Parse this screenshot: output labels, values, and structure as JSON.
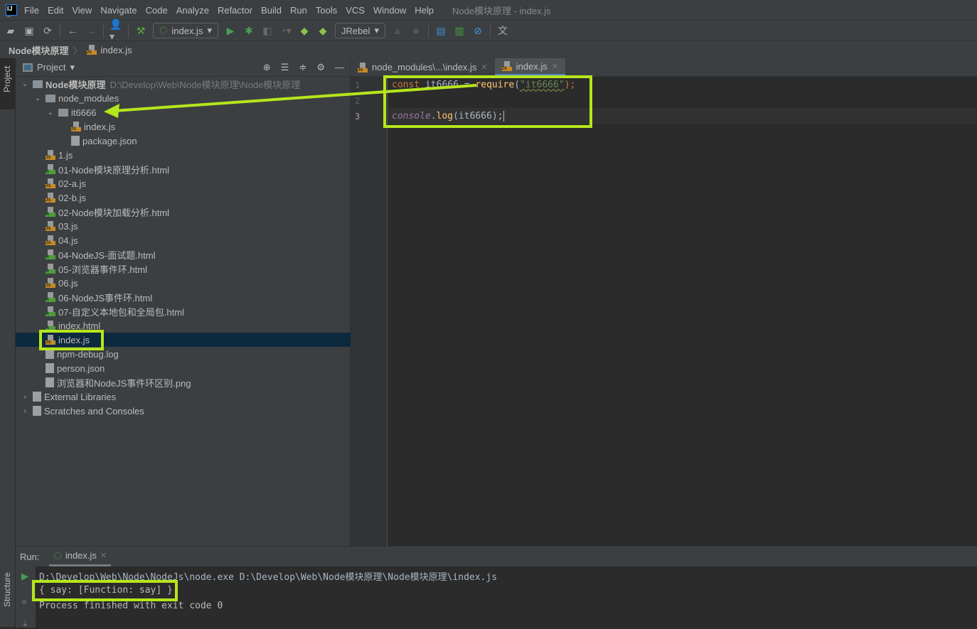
{
  "window_title": "Node模块原理 - index.js",
  "menu": [
    "File",
    "Edit",
    "View",
    "Navigate",
    "Code",
    "Analyze",
    "Refactor",
    "Build",
    "Run",
    "Tools",
    "VCS",
    "Window",
    "Help"
  ],
  "toolbar": {
    "run_config": "index.js",
    "jrebel": "JRebel"
  },
  "breadcrumb": {
    "project": "Node模块原理",
    "file": "index.js"
  },
  "side_tabs": {
    "project": "Project",
    "structure": "Structure"
  },
  "project_panel": {
    "title": "Project",
    "tree": [
      {
        "label": "Node模块原理",
        "path": "D:\\Develop\\Web\\Node模块原理\\Node模块原理",
        "depth": 0,
        "type": "module",
        "expanded": true
      },
      {
        "label": "node_modules",
        "depth": 1,
        "type": "folder",
        "expanded": true
      },
      {
        "label": "it6666",
        "depth": 2,
        "type": "folder",
        "expanded": true
      },
      {
        "label": "index.js",
        "depth": 3,
        "type": "js"
      },
      {
        "label": "package.json",
        "depth": 3,
        "type": "json"
      },
      {
        "label": "1.js",
        "depth": 1,
        "type": "js"
      },
      {
        "label": "01-Node模块原理分析.html",
        "depth": 1,
        "type": "html"
      },
      {
        "label": "02-a.js",
        "depth": 1,
        "type": "js"
      },
      {
        "label": "02-b.js",
        "depth": 1,
        "type": "js"
      },
      {
        "label": "02-Node模块加载分析.html",
        "depth": 1,
        "type": "html"
      },
      {
        "label": "03.js",
        "depth": 1,
        "type": "js"
      },
      {
        "label": "04.js",
        "depth": 1,
        "type": "js"
      },
      {
        "label": "04-NodeJS-面试题.html",
        "depth": 1,
        "type": "html"
      },
      {
        "label": "05-浏览器事件环.html",
        "depth": 1,
        "type": "html"
      },
      {
        "label": "06.js",
        "depth": 1,
        "type": "js"
      },
      {
        "label": "06-NodeJS事件环.html",
        "depth": 1,
        "type": "html"
      },
      {
        "label": "07-自定义本地包和全局包.html",
        "depth": 1,
        "type": "html"
      },
      {
        "label": "index.html",
        "depth": 1,
        "type": "html"
      },
      {
        "label": "index.js",
        "depth": 1,
        "type": "js",
        "selected": true
      },
      {
        "label": "npm-debug.log",
        "depth": 1,
        "type": "file"
      },
      {
        "label": "person.json",
        "depth": 1,
        "type": "json"
      },
      {
        "label": "浏览器和NodeJS事件环区别.png",
        "depth": 1,
        "type": "file"
      },
      {
        "label": "External Libraries",
        "depth": 0,
        "type": "lib",
        "expanded": false
      },
      {
        "label": "Scratches and Consoles",
        "depth": 0,
        "type": "scratch",
        "expanded": false
      }
    ]
  },
  "editor": {
    "tabs": [
      {
        "label": "node_modules\\...\\index.js"
      },
      {
        "label": "index.js",
        "active": true
      }
    ],
    "line_numbers": [
      "1",
      "2",
      "3"
    ],
    "line1": {
      "kw": "const",
      "rest": " it6666 = ",
      "fn": "require",
      "open": "(",
      "str": "\"it6666\"",
      "close": ");"
    },
    "line3": {
      "obj": "console",
      "dot": ".",
      "fn": "log",
      "args": "(it6666);"
    }
  },
  "run_panel": {
    "label": "Run:",
    "tab": "index.js",
    "output": [
      "D:\\Develop\\Web\\Node\\NodeJs\\node.exe D:\\Develop\\Web\\Node模块原理\\Node模块原理\\index.js",
      "{ say: [Function: say] }",
      "Process finished with exit code 0"
    ]
  },
  "colors": {
    "annotation": "#b5e61d",
    "selection": "#0d293e",
    "keyword": "#cc7832",
    "string": "#6a8759"
  }
}
